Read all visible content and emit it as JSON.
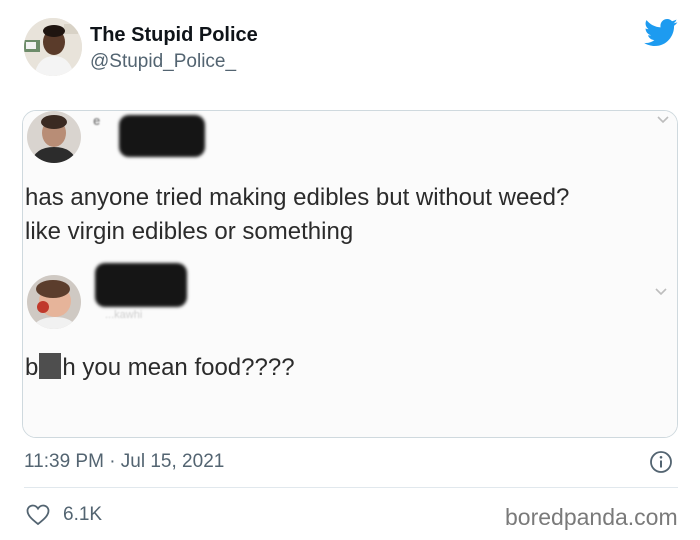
{
  "author": {
    "display_name": "The Stupid Police",
    "handle": "@Stupid_Police_"
  },
  "embedded_screenshot": {
    "first_post": {
      "name_fragment": "e",
      "text_line_1": "has anyone tried making edibles but without weed?",
      "text_line_2": "like virgin edibles or something"
    },
    "second_post": {
      "handle_fragment": "...kawhi",
      "text_before_censor": "b",
      "text_after_censor": "h you mean food????"
    }
  },
  "meta": {
    "timestamp": "11:39 PM · Jul 15, 2021",
    "likes": "6.1K"
  },
  "watermark": "boredpanda.com",
  "colors": {
    "twitter_blue": "#1d9bf0",
    "secondary_text": "#536471",
    "border": "#cfd9de"
  },
  "icons": [
    "twitter-bird-icon",
    "info-icon",
    "heart-icon",
    "chevron-down-icon"
  ]
}
